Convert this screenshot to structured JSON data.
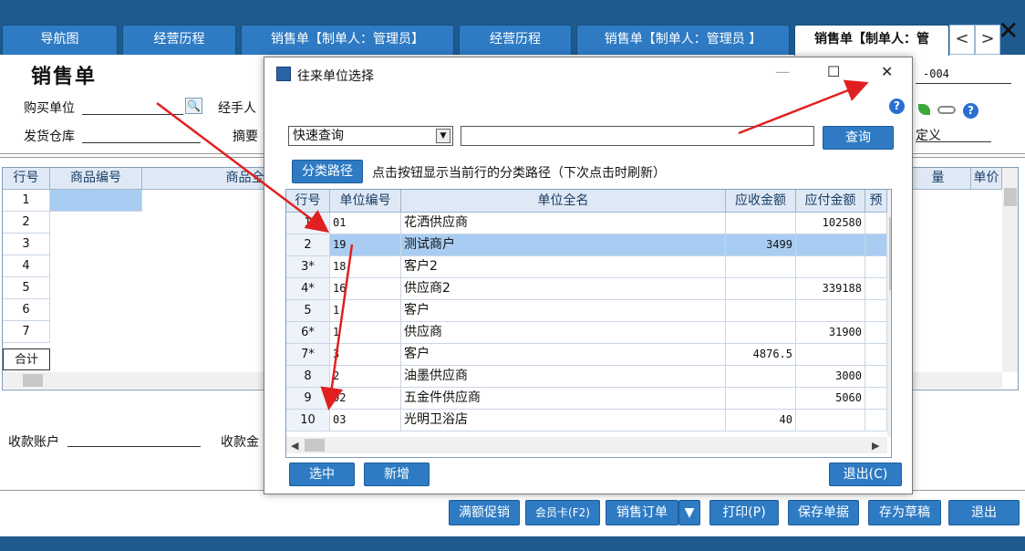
{
  "tabs": [
    "导航图",
    "经营历程",
    "销售单【制单人：管理员】",
    "经营历程",
    "销售单【制单人：管理员 】",
    "销售单【制单人：管"
  ],
  "tab_nav": {
    "prev": "<",
    "next": ">"
  },
  "close_glyph": "✕",
  "form": {
    "title": "销售单",
    "buyer_label": "购买单位",
    "handler_label": "经手人",
    "warehouse_label": "发货仓库",
    "summary_label": "摘要",
    "doc_no_suffix": "-004",
    "custom_label": "定义",
    "receive_account_label": "收款账户",
    "receive_amount_label": "收款金"
  },
  "main_grid": {
    "headers": [
      "行号",
      "商品编号",
      "商品全名",
      "量",
      "单价"
    ],
    "rows": [
      "1",
      "2",
      "3",
      "4",
      "5",
      "6",
      "7"
    ],
    "total_label": "合计"
  },
  "actions": [
    "满额促销",
    "会员卡(F2)",
    "销售订单",
    "打印(P)",
    "保存单据",
    "存为草稿",
    "退出"
  ],
  "dialog": {
    "title": "往来单位选择",
    "minimize": "—",
    "maximize": "☐",
    "close": "✕",
    "query_mode": "快速查询",
    "query_button": "查询",
    "path_button": "分类路径",
    "hint": "点击按钮显示当前行的分类路径（下次点击时刷新）",
    "headers": [
      "行号",
      "单位编号",
      "单位全名",
      "应收金额",
      "应付金额",
      "预"
    ],
    "rows": [
      {
        "no": "1",
        "code": "01",
        "name": "花洒供应商",
        "receivable": "",
        "payable": "102580"
      },
      {
        "no": "2",
        "code": "19",
        "name": "测试商户",
        "receivable": "3499",
        "payable": ""
      },
      {
        "no": "3*",
        "code": "18",
        "name": "客户2",
        "receivable": "",
        "payable": ""
      },
      {
        "no": "4*",
        "code": "16",
        "name": "供应商2",
        "receivable": "",
        "payable": "339188"
      },
      {
        "no": "5",
        "code": "1",
        "name": "客户",
        "receivable": "",
        "payable": ""
      },
      {
        "no": "6*",
        "code": "1",
        "name": "供应商",
        "receivable": "",
        "payable": "31900"
      },
      {
        "no": "7*",
        "code": "3",
        "name": "客户",
        "receivable": "4876.5",
        "payable": ""
      },
      {
        "no": "8",
        "code": "2",
        "name": "油墨供应商",
        "receivable": "",
        "payable": "3000"
      },
      {
        "no": "9",
        "code": "02",
        "name": "五金件供应商",
        "receivable": "",
        "payable": "5060"
      },
      {
        "no": "10",
        "code": "03",
        "name": "光明卫浴店",
        "receivable": "40",
        "payable": ""
      }
    ],
    "select_button": "选中",
    "new_button": "新增",
    "exit_button": "退出(C)"
  },
  "colors": {
    "brand": "#1f5a8e",
    "button": "#2e7bc4",
    "selected_row": "#a9cdf2",
    "annotation": "#e02020"
  },
  "icons": [
    "search-icon",
    "help-icon",
    "leaf-icon",
    "link-icon",
    "app-icon"
  ]
}
